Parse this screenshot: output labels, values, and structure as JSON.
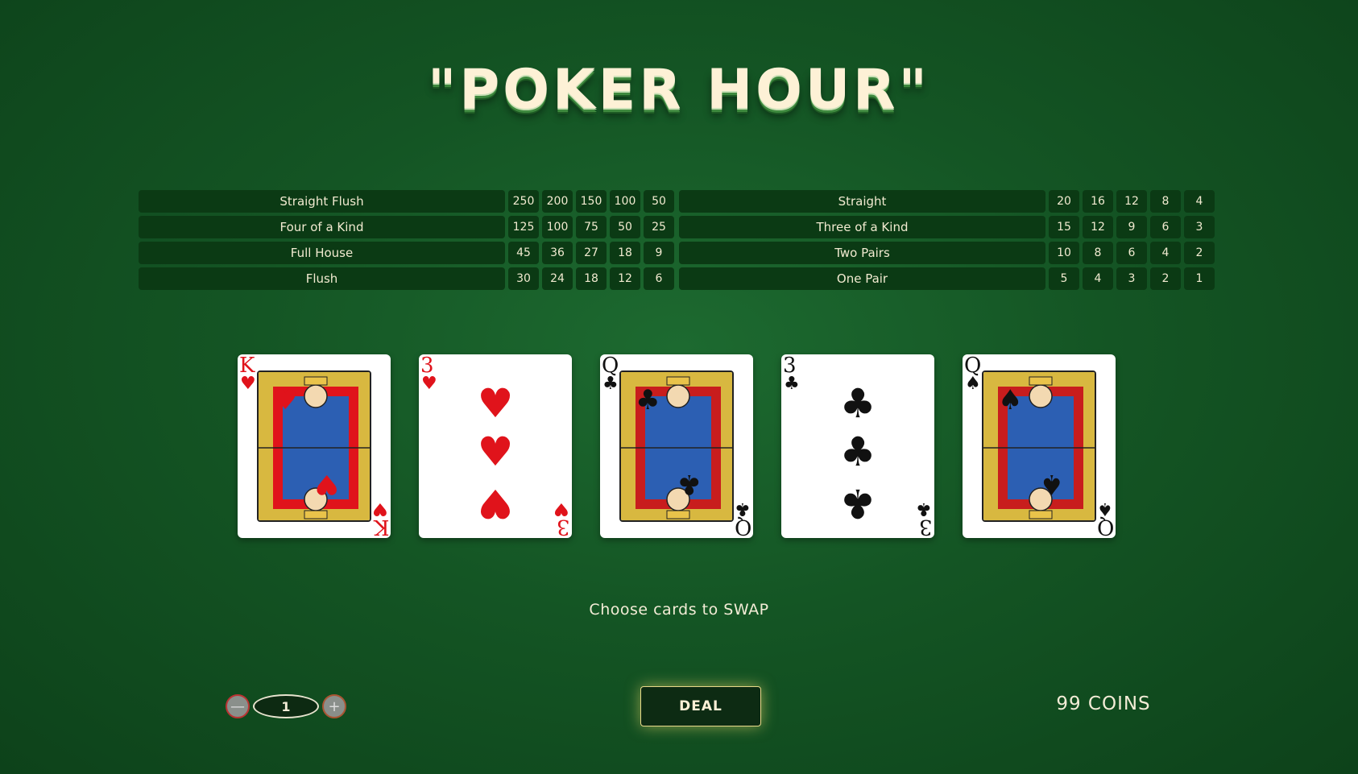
{
  "title": "\"POKER HOUR\"",
  "paytable": {
    "left": [
      {
        "hand": "Straight Flush",
        "payouts": [
          "250",
          "200",
          "150",
          "100",
          "50"
        ]
      },
      {
        "hand": "Four of a Kind",
        "payouts": [
          "125",
          "100",
          "75",
          "50",
          "25"
        ]
      },
      {
        "hand": "Full House",
        "payouts": [
          "45",
          "36",
          "27",
          "18",
          "9"
        ]
      },
      {
        "hand": "Flush",
        "payouts": [
          "30",
          "24",
          "18",
          "12",
          "6"
        ]
      }
    ],
    "right": [
      {
        "hand": "Straight",
        "payouts": [
          "20",
          "16",
          "12",
          "8",
          "4"
        ]
      },
      {
        "hand": "Three of a Kind",
        "payouts": [
          "15",
          "12",
          "9",
          "6",
          "3"
        ]
      },
      {
        "hand": "Two Pairs",
        "payouts": [
          "10",
          "8",
          "6",
          "4",
          "2"
        ]
      },
      {
        "hand": "One Pair",
        "payouts": [
          "5",
          "4",
          "3",
          "2",
          "1"
        ]
      }
    ]
  },
  "cards": [
    {
      "rank": "K",
      "suit": "♥",
      "color": "#e0131b",
      "face": true
    },
    {
      "rank": "3",
      "suit": "♥",
      "color": "#e0131b",
      "face": false
    },
    {
      "rank": "Q",
      "suit": "♣",
      "color": "#111111",
      "face": true
    },
    {
      "rank": "3",
      "suit": "♣",
      "color": "#111111",
      "face": false
    },
    {
      "rank": "Q",
      "suit": "♠",
      "color": "#111111",
      "face": true
    }
  ],
  "hint": "Choose cards to SWAP",
  "bet": {
    "minus_icon": "minus-icon",
    "value": "1",
    "plus_icon": "plus-icon"
  },
  "deal_label": "DEAL",
  "coins_label": "99 COINS"
}
